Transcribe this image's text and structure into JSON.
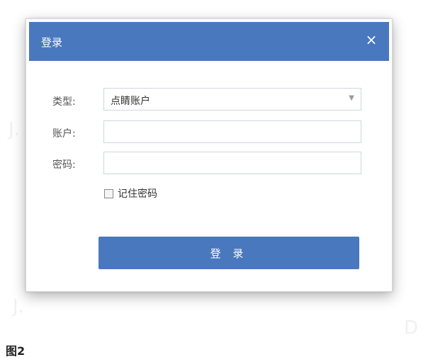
{
  "dialog": {
    "title": "登录",
    "close_icon": "×"
  },
  "form": {
    "type_label": "类型:",
    "type_value": "点睛账户",
    "account_label": "账户:",
    "account_value": "",
    "password_label": "密码:",
    "password_value": "",
    "remember_label": "记住密码",
    "remember_checked": false
  },
  "login_button": "登 录",
  "caption": "图2",
  "colors": {
    "accent": "#4a78be",
    "border": "#cfd6df"
  }
}
